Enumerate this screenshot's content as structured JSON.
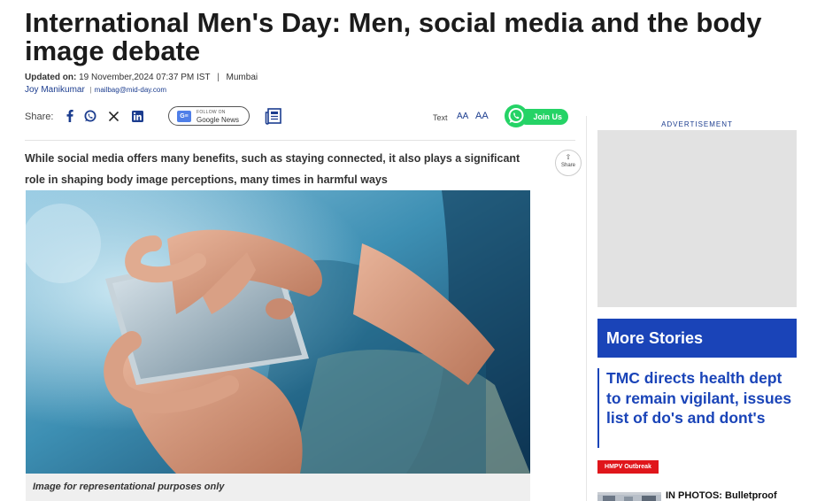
{
  "article": {
    "headline": "International Men's Day: Men, social media and the body image debate",
    "updated_label": "Updated on:",
    "updated_value": "19 November,2024 07:37 PM IST",
    "separator": "|",
    "location": "Mumbai",
    "author": "Joy Manikumar",
    "email": "mailbag@mid-day.com",
    "subhead": "While social media offers many benefits, such as staying connected, it also plays a significant role in shaping body image perceptions, many times in harmful ways",
    "image_caption": "Image for representational purposes only"
  },
  "share_bar": {
    "label": "Share:",
    "icons": [
      "facebook-icon",
      "whatsapp-icon",
      "x-icon",
      "linkedin-icon"
    ],
    "google_news_top": "FOLLOW ON",
    "google_news_name": "Google News",
    "text_label": "Text",
    "text_small": "AA",
    "text_large": "AA",
    "join_label": "Join Us"
  },
  "floating_share": {
    "label": "Share"
  },
  "sidebar": {
    "ad_label": "ADVERTISEMENT",
    "more_stories_title": "More Stories",
    "stories": [
      {
        "title": "TMC directs health dept to remain vigilant, issues list of do's and dont's",
        "tag": "HMPV Outbreak"
      },
      {
        "title": "IN PHOTOS: Bulletproof"
      }
    ]
  },
  "colors": {
    "brand_blue": "#1a44b8",
    "tag_red": "#e0161b",
    "whatsapp_green": "#25d366"
  }
}
